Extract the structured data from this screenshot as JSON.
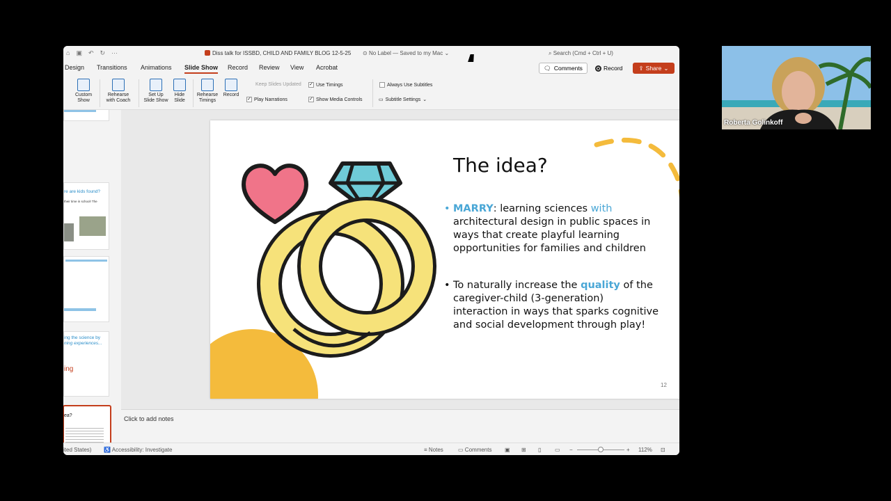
{
  "titlebar": {
    "doc_title": "Diss talk for ISSBD, CHILD AND FAMILY BLOG 12-5-25",
    "label_status": "No Label — Saved to my Mac",
    "search_placeholder": "Search (Cmd + Ctrl + U)"
  },
  "tabs": [
    {
      "label": "Design"
    },
    {
      "label": "Transitions"
    },
    {
      "label": "Animations"
    },
    {
      "label": "Slide Show",
      "active": true
    },
    {
      "label": "Record"
    },
    {
      "label": "Review"
    },
    {
      "label": "View"
    },
    {
      "label": "Acrobat"
    }
  ],
  "actions": {
    "comments": "Comments",
    "record": "Record",
    "share": "Share"
  },
  "ribbon": {
    "custom_show": [
      "Custom",
      "Show"
    ],
    "rehearse_coach": [
      "Rehearse",
      "with Coach"
    ],
    "set_up": [
      "Set Up",
      "Slide Show"
    ],
    "hide_slide": [
      "Hide",
      "Slide"
    ],
    "rehearse_timings": [
      "Rehearse",
      "Timings"
    ],
    "record": "Record",
    "keep_slides_updated": "Keep Slides Updated",
    "play_narrations": "Play Narrations",
    "use_timings": "Use Timings",
    "show_media_controls": "Show Media Controls",
    "always_use_subtitles": "Always Use Subtitles",
    "subtitle_settings": "Subtitle Settings"
  },
  "thumbnails": {
    "t1": "re are kids found?",
    "t1b": "their time in school! The",
    "t3": "ing the science by",
    "t3b": "ning experiences...",
    "t3c": "ing",
    "t4": "ea?"
  },
  "slide": {
    "title": "The idea?",
    "bullet1_hl": "MARRY",
    "bullet1_a": ":  learning sciences ",
    "bullet1_with": "with",
    "bullet1_lines": [
      "architectural design in public spaces in",
      "ways that create playful learning",
      "opportunities for families and children"
    ],
    "bullet2_a": "To naturally increase the ",
    "bullet2_hl": "quality",
    "bullet2_b": " of the",
    "bullet2_lines": [
      "caregiver-child (3-generation)",
      "interaction in ways that sparks cognitive",
      "and social development through play!"
    ],
    "number": "12"
  },
  "notes_placeholder": "Click to add notes",
  "status": {
    "language": "ited States)",
    "accessibility": "Accessibility: Investigate",
    "notes": "Notes",
    "comments": "Comments",
    "zoom": "112%"
  },
  "participant": {
    "name": "Roberta Golinkoff"
  },
  "colors": {
    "accent": "#c43e1c",
    "highlight_blue": "#4aa7d6",
    "ring_yellow": "#f6e27a",
    "heart_pink": "#f07489",
    "diamond_teal": "#6fcbd7"
  }
}
